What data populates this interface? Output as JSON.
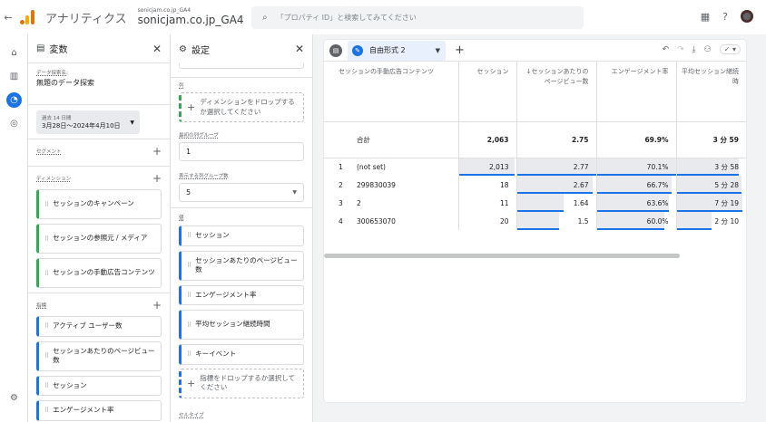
{
  "header": {
    "back_icon": "arrow-back-icon",
    "app_name": "アナリティクス",
    "property_small": "sonicjam.co.jp_GA4",
    "property_name": "sonicjam.co.jp_GA4",
    "search_placeholder": "「プロパティ ID」と検索してみてください"
  },
  "variables": {
    "title": "変数",
    "exploration_label": "データ探索名:",
    "exploration_name": "無題のデータ探索",
    "date_label": "過去 14 日間",
    "date_range": "3月28日～2024年4月10日",
    "segments_label": "セグメント",
    "dimensions_label": "ディメンション",
    "dimensions": [
      "セッションのキャンペーン",
      "セッションの参照元 / メディア",
      "セッションの手動広告コンテンツ"
    ],
    "metrics_label": "指標",
    "metrics": [
      "アクティブ ユーザー数",
      "セッションあたりのページビュー数",
      "セッション",
      "エンゲージメント率"
    ]
  },
  "settings": {
    "title": "設定",
    "columns_label": "列",
    "columns_drop": "ディメンションをドロップするか選択してください",
    "first_group_label": "最初の列グループ",
    "first_group_value": "1",
    "groups_count_label": "表示する列グループ数",
    "groups_count_value": "5",
    "values_label": "値",
    "values": [
      "セッション",
      "セッションあたりのページビュー数",
      "エンゲージメント率",
      "平均セッション継続時間",
      "キーイベント"
    ],
    "values_drop": "指標をドロップするか選択してください",
    "cell_type_label": "セルタイプ"
  },
  "main": {
    "tab_name": "自由形式 2",
    "columns": [
      "セッションの手動広告コンテンツ",
      "セッション",
      "↓セッションあたりのページビュー数",
      "エンゲージメント率",
      "平均セッション継続時"
    ],
    "total": {
      "label": "合計",
      "sessions": "2,063",
      "ppv": "2.75",
      "engagement": "69.9%",
      "duration": "3 分 59"
    },
    "rows": [
      {
        "num": "1",
        "dim": "(not set)",
        "sessions": "2,013",
        "ppv": "2.77",
        "engagement": "70.1%",
        "duration": "3 分 58"
      },
      {
        "num": "2",
        "dim": "299830039",
        "sessions": "18",
        "ppv": "2.67",
        "engagement": "66.7%",
        "duration": "5 分 28"
      },
      {
        "num": "3",
        "dim": "2",
        "sessions": "11",
        "ppv": "1.64",
        "engagement": "63.6%",
        "duration": "7 分 19"
      },
      {
        "num": "4",
        "dim": "300653070",
        "sessions": "20",
        "ppv": "1.5",
        "engagement": "60.0%",
        "duration": "2 分 10"
      }
    ],
    "bar_fraction": {
      "sessions": [
        0.97,
        0,
        0,
        0
      ],
      "ppv": [
        1.0,
        0.96,
        0.59,
        0.54
      ],
      "engagement": [
        1.0,
        0.95,
        0.91,
        0.86
      ],
      "duration": [
        0.9,
        0.93,
        0.95,
        0.5
      ]
    }
  }
}
